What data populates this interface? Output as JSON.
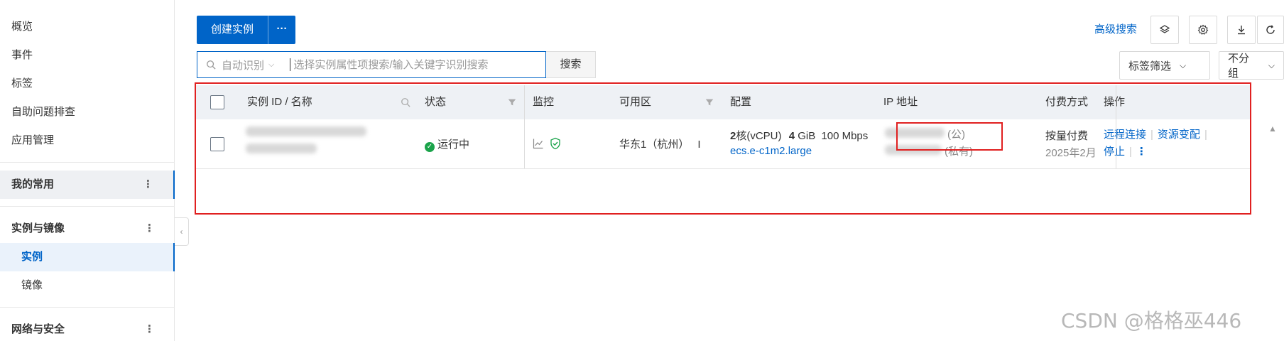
{
  "sidebar": {
    "items": [
      {
        "label": "概览"
      },
      {
        "label": "事件"
      },
      {
        "label": "标签"
      },
      {
        "label": "自助问题排查"
      },
      {
        "label": "应用管理"
      }
    ],
    "favorites": {
      "label": "我的常用"
    },
    "group_instances": {
      "label": "实例与镜像",
      "children": [
        {
          "label": "实例",
          "active": true
        },
        {
          "label": "镜像"
        }
      ]
    },
    "group_network": {
      "label": "网络与安全"
    },
    "collapse_glyph": "‹"
  },
  "toolbar": {
    "create_label": "创建实例",
    "more_label": "···",
    "search_mode": "自动识别",
    "search_placeholder": "选择实例属性项搜索/输入关键字识别搜索",
    "search_button": "搜索",
    "advanced_search": "高级搜索",
    "tag_filter": "标签筛选",
    "group_select": "不分组",
    "icons": [
      "layers-icon",
      "settings-icon",
      "download-icon",
      "refresh-icon"
    ]
  },
  "table": {
    "columns": [
      "实例 ID / 名称",
      "状态",
      "监控",
      "可用区",
      "配置",
      "IP 地址",
      "付费方式",
      "操作"
    ],
    "rows": [
      {
        "status": "运行中",
        "zone": "华东1（杭州）",
        "zone_suffix": "I",
        "config_cpu": "2",
        "config_cpu_unit": "核(vCPU)",
        "config_mem": "4",
        "config_mem_unit": "GiB",
        "config_bw": "100 Mbps",
        "instance_type": "ecs.e-c1m2.large",
        "ip_public_tag": "(公)",
        "ip_private_tag": "(私有)",
        "billing": "按量付费",
        "billing_date": "2025年2月",
        "actions": [
          "远程连接",
          "资源变配",
          "停止"
        ]
      }
    ]
  },
  "colors": {
    "accent": "#0064c8",
    "highlight_border": "#e02020",
    "status_running": "#1aa34a"
  },
  "watermark": "CSDN @格格巫446"
}
